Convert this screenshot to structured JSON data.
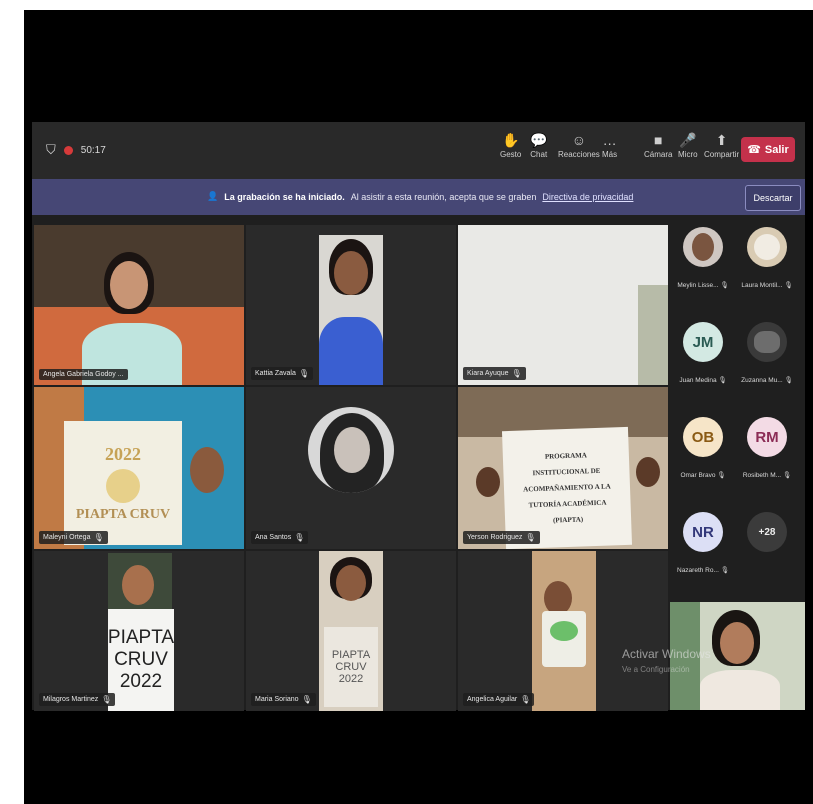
{
  "topbar": {
    "timer": "50:17",
    "tools": [
      {
        "icon": "raise-hand-icon",
        "glyph": "✋",
        "label": "Gesto"
      },
      {
        "icon": "chat-icon",
        "glyph": "💬",
        "label": "Chat"
      },
      {
        "icon": "reactions-icon",
        "glyph": "☺",
        "label": "Reacciones"
      },
      {
        "icon": "more-icon",
        "glyph": "…",
        "label": "Más"
      },
      {
        "icon": "camera-icon",
        "glyph": "■",
        "label": "Cámara"
      },
      {
        "icon": "mic-icon",
        "glyph": "🎤",
        "label": "Micro"
      },
      {
        "icon": "share-icon",
        "glyph": "⬆",
        "label": "Compartir"
      }
    ],
    "leave_label": "Salir"
  },
  "banner": {
    "bold": "La grabación se ha iniciado.",
    "text": "Al asistir a esta reunión, acepta que se graben",
    "link": "Directiva de privacidad",
    "dismiss": "Descartar"
  },
  "tiles": [
    {
      "name": "Angela Gabriela Godoy ..."
    },
    {
      "name": "Kattia Zavala"
    },
    {
      "name": "Kiara Ayuque"
    },
    {
      "name": "Maleyni Ortega"
    },
    {
      "name": "Ana Santos"
    },
    {
      "name": "Yerson Rodriguez"
    },
    {
      "name": "Milagros Martinez"
    },
    {
      "name": "Maria Soriano"
    },
    {
      "name": "Angelica Aguilar"
    }
  ],
  "signs": {
    "sign1_year": "2022",
    "sign1_text": "PIAPTA CRUV",
    "sign2_lines": [
      "PROGRAMA",
      "INSTITUCIONAL DE",
      "ACOMPAÑAMIENTO A LA",
      "TUTORÍA ACADÉMICA",
      "(PIAPTA)"
    ],
    "sign3_lines": [
      "PIAPTA",
      "CRUV",
      "2022"
    ],
    "sign4_lines": [
      "PIAPTA",
      "CRUV",
      "2022"
    ]
  },
  "participants": [
    {
      "initials": "",
      "label": "Meylin Lisse...",
      "bg": "#cfc7c2",
      "fg": "#333"
    },
    {
      "initials": "",
      "label": "Laura Montil...",
      "bg": "#d9cbb3",
      "fg": "#333"
    },
    {
      "initials": "JM",
      "label": "Juan Medina",
      "bg": "#d3e9e3",
      "fg": "#2a5b53"
    },
    {
      "initials": "",
      "label": "Zuzanna Mu...",
      "bg": "#3a3a3a",
      "fg": "#ddd"
    },
    {
      "initials": "OB",
      "label": "Omar Bravo",
      "bg": "#f6e5c8",
      "fg": "#8a5a14"
    },
    {
      "initials": "RM",
      "label": "Rosibeth M...",
      "bg": "#f3dbe5",
      "fg": "#8b2c55"
    },
    {
      "initials": "NR",
      "label": "Nazareth Ro...",
      "bg": "#dcdff5",
      "fg": "#33387a"
    },
    {
      "initials": "+28",
      "label": "",
      "bg": "#3b3b3b",
      "fg": "#eeeeee"
    }
  ],
  "watermark": {
    "line1": "Activar Windows",
    "line2": "Ve a Configuración"
  }
}
